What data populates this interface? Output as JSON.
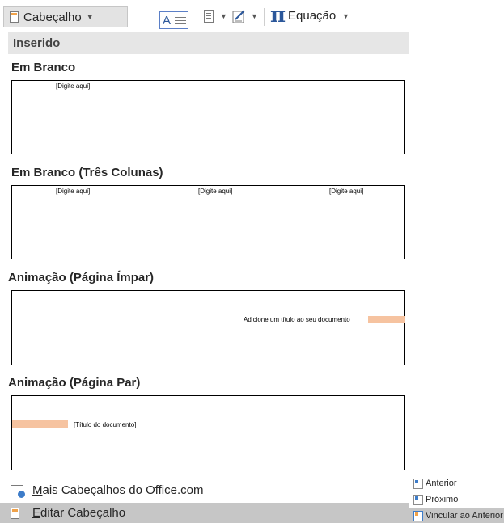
{
  "ribbon": {
    "header_button_label": "Cabeçalho",
    "equation_label": "Equação"
  },
  "gallery": {
    "section_label": "Inserido",
    "items": [
      {
        "title": "Em Branco",
        "placeholders": [
          "[Digite aqui]"
        ]
      },
      {
        "title": "Em Branco (Três Colunas)",
        "placeholders": [
          "[Digite aqui]",
          "[Digite aqui]",
          "[Digite aqui]"
        ]
      },
      {
        "title": "Animação (Página Ímpar)",
        "placeholders": [
          "Adicione um título ao seu documento"
        ]
      },
      {
        "title": "Animação (Página Par)",
        "placeholders": [
          "[Título do documento]"
        ]
      }
    ]
  },
  "menu": {
    "more_headers": {
      "accel": "M",
      "rest": "ais Cabeçalhos do Office.com"
    },
    "edit_header": {
      "accel": "E",
      "rest": "ditar Cabeçalho"
    }
  },
  "nav": {
    "anterior": "Anterior",
    "proximo": "Próximo",
    "vincular": "Vincular ao Anterior"
  },
  "colors": {
    "accent_peach": "#f6c3a0",
    "section_bar": "#e6e6e6",
    "selected_row": "#c6c6c6",
    "icon_blue": "#2b579a"
  }
}
